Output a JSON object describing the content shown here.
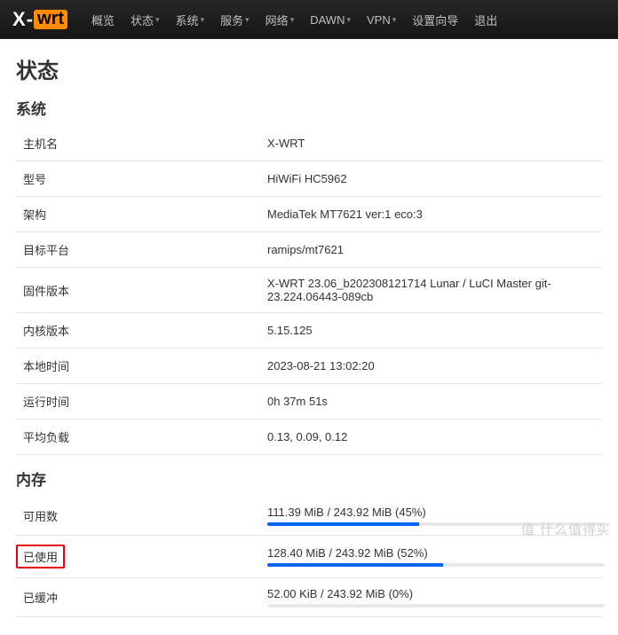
{
  "brand": {
    "x": "X",
    "dash": "-",
    "wrt": "wrt"
  },
  "nav": {
    "items": [
      {
        "label": "概览",
        "caret": false
      },
      {
        "label": "状态",
        "caret": true
      },
      {
        "label": "系统",
        "caret": true
      },
      {
        "label": "服务",
        "caret": true
      },
      {
        "label": "网络",
        "caret": true
      },
      {
        "label": "DAWN",
        "caret": true
      },
      {
        "label": "VPN",
        "caret": true
      },
      {
        "label": "设置向导",
        "caret": false
      },
      {
        "label": "退出",
        "caret": false
      }
    ]
  },
  "page_title": "状态",
  "sections": {
    "system": {
      "title": "系统",
      "rows": {
        "hostname": {
          "label": "主机名",
          "value": "X-WRT"
        },
        "model": {
          "label": "型号",
          "value": "HiWiFi HC5962"
        },
        "arch": {
          "label": "架构",
          "value": "MediaTek MT7621 ver:1 eco:3"
        },
        "target": {
          "label": "目标平台",
          "value": "ramips/mt7621"
        },
        "firmware": {
          "label": "固件版本",
          "value": "X-WRT 23.06_b202308121714 Lunar / LuCI Master git-23.224.06443-089cb"
        },
        "kernel": {
          "label": "内核版本",
          "value": "5.15.125"
        },
        "localtime": {
          "label": "本地时间",
          "value": "2023-08-21 13:02:20"
        },
        "uptime": {
          "label": "运行时间",
          "value": "0h 37m 51s"
        },
        "load": {
          "label": "平均负载",
          "value": "0.13, 0.09, 0.12"
        }
      }
    },
    "memory": {
      "title": "内存",
      "rows": {
        "available": {
          "label": "可用数",
          "text": "111.39 MiB / 243.92 MiB (45%)",
          "percent": 45
        },
        "used": {
          "label": "已使用",
          "text": "128.40 MiB / 243.92 MiB (52%)",
          "percent": 52,
          "highlight": true
        },
        "buffered": {
          "label": "已缓冲",
          "text": "52.00 KiB / 243.92 MiB (0%)",
          "percent": 0
        }
      }
    }
  },
  "watermark": "值 什么值得买"
}
